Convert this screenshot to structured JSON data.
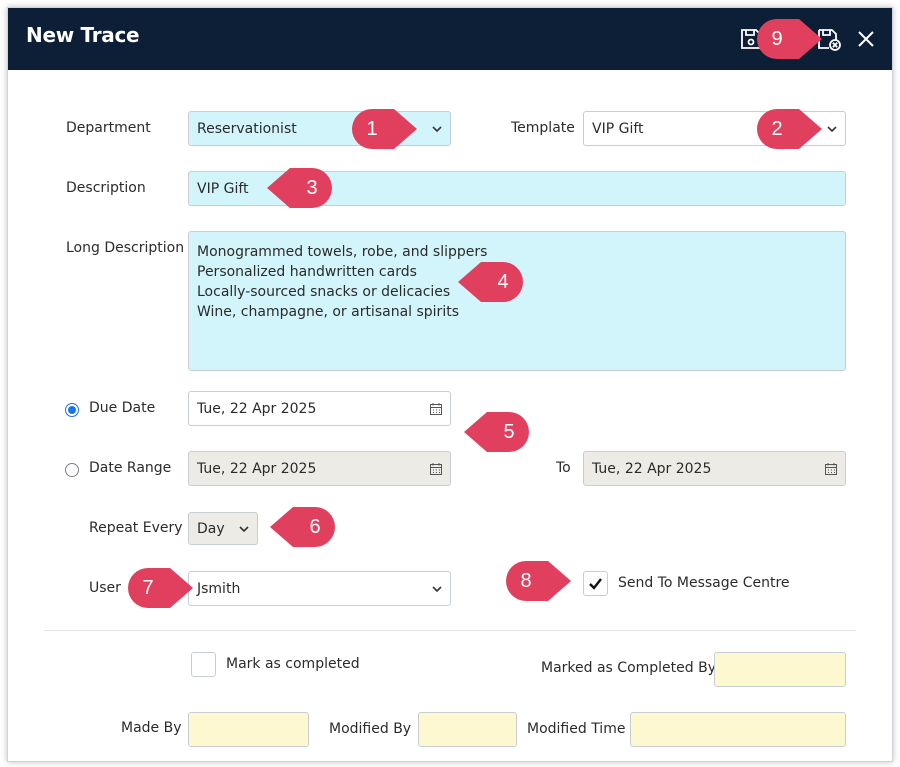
{
  "window": {
    "title": "New Trace"
  },
  "toolbar": {
    "save_icon": "save-icon",
    "save_close_icon": "save-close-icon",
    "close_icon": "close-icon"
  },
  "form": {
    "department": {
      "label": "Department",
      "value": "Reservationist"
    },
    "template": {
      "label": "Template",
      "value": "VIP Gift"
    },
    "description": {
      "label": "Description",
      "value": "VIP Gift"
    },
    "long_description": {
      "label": "Long Description",
      "lines": [
        "Monogrammed towels, robe, and slippers",
        "Personalized handwritten cards",
        "Locally-sourced snacks or delicacies",
        "Wine, champagne, or artisanal spirits"
      ]
    },
    "due_date": {
      "label": "Due Date",
      "value": "Tue, 22 Apr 2025",
      "selected": true
    },
    "date_range": {
      "label": "Date Range",
      "from": "Tue, 22 Apr 2025",
      "to_label": "To",
      "to": "Tue, 22 Apr 2025",
      "selected": false
    },
    "repeat_every": {
      "label": "Repeat Every",
      "value": "Day"
    },
    "user": {
      "label": "User",
      "value": "Jsmith"
    },
    "send_to_message_centre": {
      "label": "Send To Message Centre",
      "checked": true
    },
    "mark_as_completed": {
      "label": "Mark as completed",
      "checked": false
    },
    "marked_as_completed_by": {
      "label": "Marked as Completed By",
      "value": ""
    },
    "made_by": {
      "label": "Made By",
      "value": ""
    },
    "modified_by": {
      "label": "Modified By",
      "value": ""
    },
    "modified_time": {
      "label": "Modified Time",
      "value": ""
    }
  },
  "callouts": [
    "1",
    "2",
    "3",
    "4",
    "5",
    "6",
    "7",
    "8",
    "9"
  ],
  "colors": {
    "titlebar": "#0d1f37",
    "callout": "#e0405e",
    "editable_field": "#d2f5fb",
    "readonly_field": "#fdf8cf",
    "disabled_field": "#ecebe6",
    "radio_selected": "#1a73e8"
  }
}
